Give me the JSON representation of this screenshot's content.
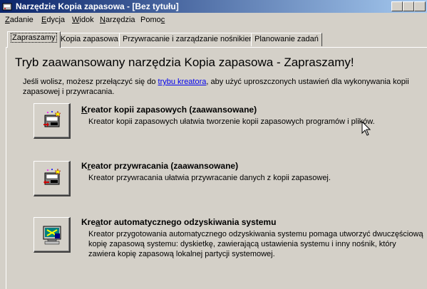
{
  "window": {
    "title": "Narzędzie Kopia zapasowa - [Bez tytułu]"
  },
  "menu": [
    {
      "label": "Zadanie",
      "accel": "Z"
    },
    {
      "label": "Edycja",
      "accel": "E"
    },
    {
      "label": "Widok",
      "accel": "W"
    },
    {
      "label": "Narzędzia",
      "accel": "N"
    },
    {
      "label": "Pomoc",
      "accel": "c"
    }
  ],
  "tabs": [
    {
      "label": "Zapraszamy",
      "active": true
    },
    {
      "label": "Kopia zapasowa",
      "active": false
    },
    {
      "label": "Przywracanie i zarządzanie nośnikiem",
      "active": false
    },
    {
      "label": "Planowanie zadań",
      "active": false
    }
  ],
  "welcome": {
    "heading": "Tryb zaawansowany narzędzia Kopia zapasowa - Zapraszamy!",
    "intro_before": "Jeśli wolisz, możesz przełączyć się do ",
    "intro_link": "trybu kreatora",
    "intro_after": ", aby użyć uproszczonych ustawień dla wykonywania kopii zapasowej i przywracania."
  },
  "wizards": [
    {
      "icon": "backup-wizard-icon",
      "title_accel": "K",
      "title_rest": "reator kopii zapasowych (zaawansowane)",
      "description": "Kreator kopii zapasowych ułatwia tworzenie kopii zapasowych programów i plików."
    },
    {
      "icon": "restore-wizard-icon",
      "title_pre": "K",
      "title_accel": "r",
      "title_rest": "eator przywracania (zaawansowane)",
      "description": "Kreator przywracania ułatwia przywracanie danych z kopii zapasowej."
    },
    {
      "icon": "asr-wizard-icon",
      "title_pre": "Kre",
      "title_accel": "a",
      "title_rest": "tor automatycznego odzyskiwania systemu",
      "description": "Kreator przygotowania automatycznego odzyskiwania systemu pomaga utworzyć dwuczęściową kopię zapasową systemu: dyskietkę, zawierającą ustawienia systemu i inny nośnik, który zawiera kopię zapasową lokalnej partycji systemowej."
    }
  ],
  "colors": {
    "face": "#d4d0c8",
    "title_start": "#0a246a",
    "title_end": "#a6caf0",
    "link": "#0000ee"
  }
}
